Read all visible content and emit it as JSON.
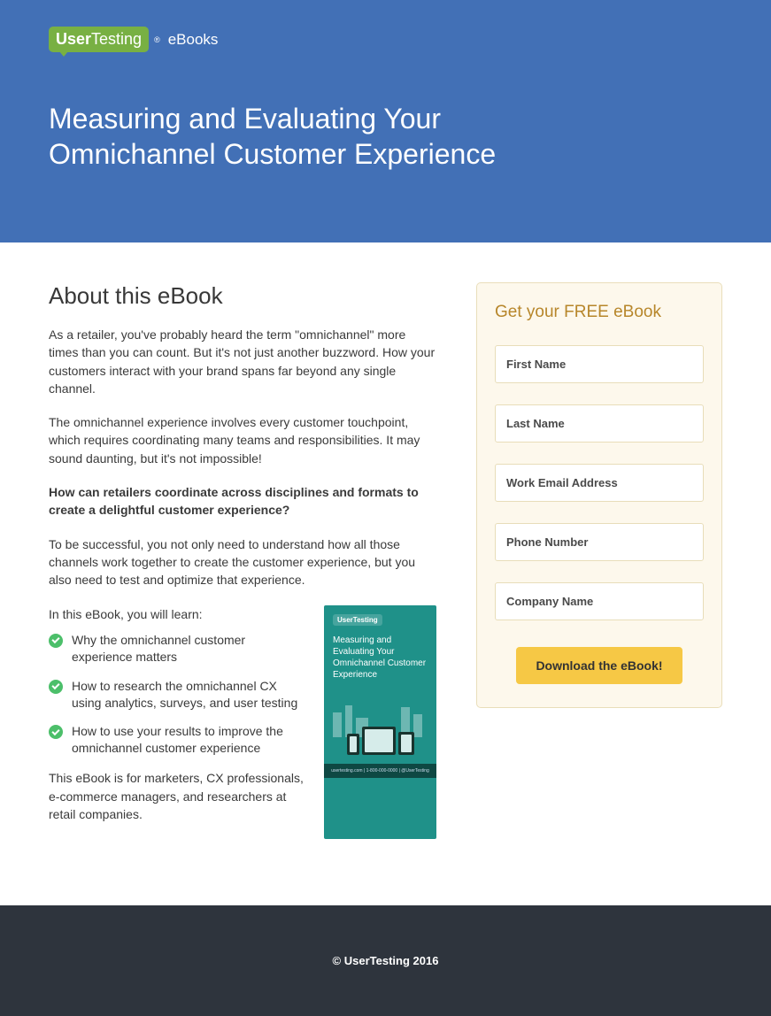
{
  "header": {
    "logo_user": "User",
    "logo_testing": "Testing",
    "logo_section": "eBooks",
    "title": "Measuring and Evaluating Your Omnichannel Customer Experience"
  },
  "about": {
    "heading": "About this eBook",
    "p1": "As a retailer, you've probably heard the term \"omnichannel\" more times than you can count. But it's not just another buzzword. How your customers interact with your brand spans far beyond any single channel.",
    "p2": "The omnichannel experience involves every customer touchpoint, which requires coordinating many teams and responsibilities. It may sound daunting, but it's not impossible!",
    "p3_bold": "How can retailers coordinate across disciplines and formats to create a delightful customer experience?",
    "p4": "To be successful, you not only need to understand how all those channels work together to create the customer experience, but you also need to test and optimize that experience.",
    "learn_intro": "In this eBook, you will learn:",
    "bullets": [
      "Why the omnichannel customer experience matters",
      "How to research the omnichannel CX using analytics, surveys, and user testing",
      "How to use your results to improve the omnichannel customer experience"
    ],
    "closing": "This eBook is for marketers, CX professionals, e-commerce managers, and researchers at retail companies."
  },
  "cover": {
    "brand": "UserTesting",
    "title": "Measuring and Evaluating Your Omnichannel Customer Experience",
    "footer": "usertesting.com | 1-800-000-0000 | @UserTesting"
  },
  "form": {
    "heading": "Get your FREE eBook",
    "fields": {
      "first_name": "First Name",
      "last_name": "Last Name",
      "email": "Work Email Address",
      "phone": "Phone Number",
      "company": "Company Name"
    },
    "submit": "Download the eBook!"
  },
  "footer": {
    "copyright": "© UserTesting 2016"
  }
}
